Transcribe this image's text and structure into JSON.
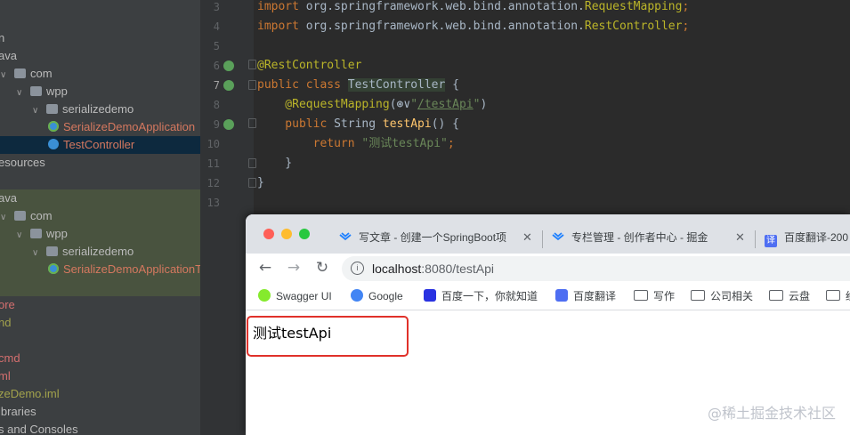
{
  "project_tree": [
    {
      "label": "n",
      "indent": 0,
      "type": "text",
      "color": "default"
    },
    {
      "label": "ava",
      "indent": 0,
      "type": "text",
      "color": "default"
    },
    {
      "label": "com",
      "indent": 1,
      "type": "pkg",
      "color": "default"
    },
    {
      "label": "wpp",
      "indent": 2,
      "type": "pkg",
      "color": "default"
    },
    {
      "label": "serializedemo",
      "indent": 3,
      "type": "pkg",
      "color": "default"
    },
    {
      "label": "SerializeDemoApplication",
      "indent": 4,
      "type": "spring",
      "color": "orange"
    },
    {
      "label": "TestController",
      "indent": 4,
      "type": "cls",
      "color": "orange",
      "selected": true
    },
    {
      "label": "esources",
      "indent": 0,
      "type": "text",
      "color": "default"
    },
    {
      "label": "",
      "indent": 0,
      "type": "text",
      "color": "default"
    },
    {
      "label": "ava",
      "indent": 0,
      "type": "text",
      "color": "default"
    },
    {
      "label": "com",
      "indent": 1,
      "type": "pkg",
      "color": "default"
    },
    {
      "label": "wpp",
      "indent": 2,
      "type": "pkg",
      "color": "default"
    },
    {
      "label": "serializedemo",
      "indent": 3,
      "type": "pkg",
      "color": "default"
    },
    {
      "label": "SerializeDemoApplicationT",
      "indent": 4,
      "type": "spring",
      "color": "orange"
    },
    {
      "label": "",
      "indent": 0,
      "type": "text",
      "color": "default"
    },
    {
      "label": "ore",
      "indent": 0,
      "type": "text",
      "color": "red"
    },
    {
      "label": "nd",
      "indent": 0,
      "type": "text",
      "color": "olive"
    },
    {
      "label": "",
      "indent": 0,
      "type": "text",
      "color": "default"
    },
    {
      "label": "cmd",
      "indent": 0,
      "type": "text",
      "color": "red"
    },
    {
      "label": "ml",
      "indent": 0,
      "type": "text",
      "color": "red"
    },
    {
      "label": "zeDemo.iml",
      "indent": 0,
      "type": "text",
      "color": "olive"
    },
    {
      "label": "ibraries",
      "indent": 0,
      "type": "text",
      "color": "default"
    },
    {
      "label": "s and Consoles",
      "indent": 0,
      "type": "text",
      "color": "default"
    }
  ],
  "editor": {
    "lines": [
      {
        "num": "3",
        "tokens": [
          {
            "t": "import ",
            "c": "kw"
          },
          {
            "t": "org.springframework.web.bind.annotation.",
            "c": "plain"
          },
          {
            "t": "RequestMapping",
            "c": "ann"
          },
          {
            "t": ";",
            "c": "kw"
          }
        ]
      },
      {
        "num": "4",
        "tokens": [
          {
            "t": "import ",
            "c": "kw"
          },
          {
            "t": "org.springframework.web.bind.annotation.",
            "c": "plain"
          },
          {
            "t": "RestController",
            "c": "ann"
          },
          {
            "t": ";",
            "c": "kw"
          }
        ]
      },
      {
        "num": "5",
        "tokens": []
      },
      {
        "num": "6",
        "tokens": [
          {
            "t": "@",
            "c": "ann"
          },
          {
            "t": "RestController",
            "c": "ann"
          }
        ],
        "icon": true
      },
      {
        "num": "7",
        "tokens": [
          {
            "t": "public ",
            "c": "kw"
          },
          {
            "t": "class ",
            "c": "kw"
          },
          {
            "t": "TestController",
            "c": "clsname"
          },
          {
            "t": " {",
            "c": "plain"
          }
        ],
        "icon": true,
        "current": true
      },
      {
        "num": "8",
        "tokens": [
          {
            "t": "    @RequestMapping",
            "c": "ann"
          },
          {
            "t": "(",
            "c": "plain"
          },
          {
            "t": "⊛∨",
            "c": "plain"
          },
          {
            "t": "\"",
            "c": "str"
          },
          {
            "t": "/testApi",
            "c": "strurl"
          },
          {
            "t": "\"",
            "c": "str"
          },
          {
            "t": ")",
            "c": "plain"
          }
        ]
      },
      {
        "num": "9",
        "tokens": [
          {
            "t": "    public ",
            "c": "kw"
          },
          {
            "t": "String ",
            "c": "plain"
          },
          {
            "t": "testApi",
            "c": "fn"
          },
          {
            "t": "() {",
            "c": "plain"
          }
        ],
        "icon": true
      },
      {
        "num": "10",
        "tokens": [
          {
            "t": "        return ",
            "c": "kw"
          },
          {
            "t": "\"测试testApi\"",
            "c": "str"
          },
          {
            "t": ";",
            "c": "kw"
          }
        ]
      },
      {
        "num": "11",
        "tokens": [
          {
            "t": "    }",
            "c": "plain"
          }
        ]
      },
      {
        "num": "12",
        "tokens": [
          {
            "t": "}",
            "c": "plain"
          }
        ]
      },
      {
        "num": "13",
        "tokens": []
      }
    ]
  },
  "browser": {
    "tabs": [
      {
        "title": "写文章 - 创建一个SpringBoot项",
        "close": "✕"
      },
      {
        "title": "专栏管理 - 创作者中心 - 掘金",
        "close": "✕"
      },
      {
        "title": "百度翻译-200",
        "close": ""
      }
    ],
    "nav": {
      "back": "←",
      "forward": "→",
      "reload": "↻"
    },
    "url_host": "localhost",
    "url_rest": ":8080/testApi",
    "info_icon": "i",
    "bookmarks": [
      {
        "label": "Swagger UI",
        "icon": "swagger",
        "color": "#85ea2d"
      },
      {
        "label": "Google",
        "icon": "google",
        "color": "#4285f4"
      },
      {
        "label": "百度一下，你就知道",
        "icon": "baidu",
        "color": "#2932e1"
      },
      {
        "label": "百度翻译",
        "icon": "fanyi",
        "color": "#4e6ef2"
      },
      {
        "label": "写作",
        "icon": "folder"
      },
      {
        "label": "公司相关",
        "icon": "folder"
      },
      {
        "label": "云盘",
        "icon": "folder"
      },
      {
        "label": "经",
        "icon": "folder"
      }
    ],
    "response_text": "测试testApi"
  },
  "watermark": "@稀土掘金技术社区",
  "colors": {
    "traffic_red": "#ff5f57",
    "traffic_yellow": "#febc2e",
    "traffic_green": "#28c840",
    "highlight_box": "#e0312a"
  }
}
